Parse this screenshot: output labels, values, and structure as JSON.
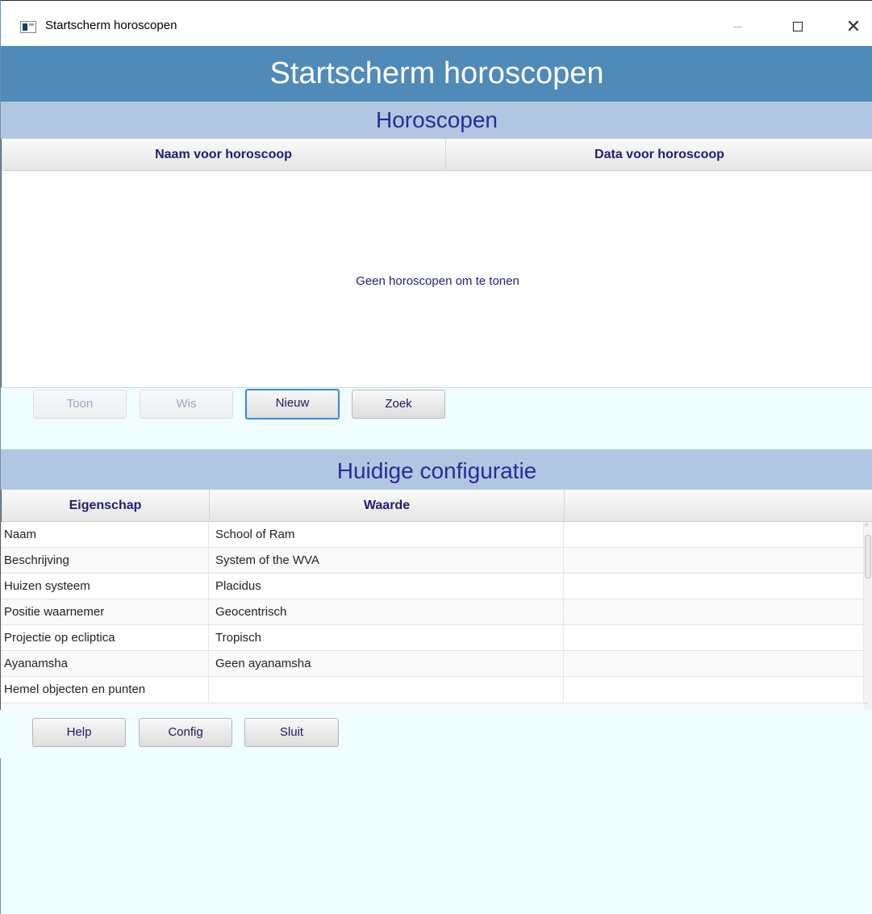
{
  "window": {
    "title": "Startscherm horoscopen",
    "minimize_icon": "minimize-icon",
    "maximize_icon": "maximize-icon",
    "close_icon": "close-icon",
    "close_glyph": "✕"
  },
  "header": {
    "title": "Startscherm horoscopen"
  },
  "horoscopes": {
    "section_title": "Horoscopen",
    "columns": [
      "Naam voor horoscoop",
      "Data voor horoscoop"
    ],
    "empty_message": "Geen horoscopen om te tonen",
    "buttons": {
      "show": "Toon",
      "delete": "Wis",
      "new": "Nieuw",
      "search": "Zoek"
    }
  },
  "configuration": {
    "section_title": "Huidige configuratie",
    "columns": [
      "Eigenschap",
      "Waarde",
      ""
    ],
    "rows": [
      {
        "property": "Naam",
        "value": "School of Ram"
      },
      {
        "property": "Beschrijving",
        "value": "System of the WVA"
      },
      {
        "property": "Huizen systeem",
        "value": "Placidus"
      },
      {
        "property": "Positie waarnemer",
        "value": "Geocentrisch"
      },
      {
        "property": "Projectie op ecliptica",
        "value": "Tropisch"
      },
      {
        "property": "Ayanamsha",
        "value": "Geen ayanamsha"
      },
      {
        "property": "Hemel objecten en punten",
        "value": ""
      }
    ]
  },
  "footer_buttons": {
    "help": "Help",
    "config": "Config",
    "close": "Sluit"
  },
  "colors": {
    "header_bg": "#4f8ab9",
    "section_bg": "#b1c7e1",
    "section_text": "#2b2a99",
    "window_bg": "#f0feff",
    "focus": "#2d8fd5"
  }
}
